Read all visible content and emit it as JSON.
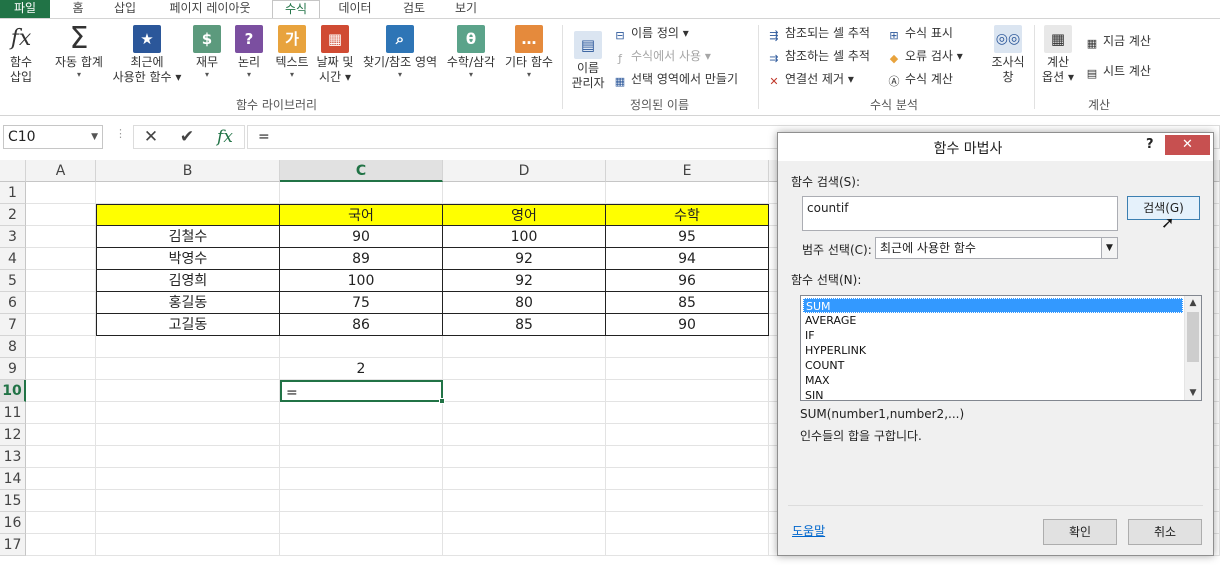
{
  "tabs": [
    "파일",
    "홈",
    "삽입",
    "페이지 레이아웃",
    "수식",
    "데이터",
    "검토",
    "보기"
  ],
  "ribbon": {
    "insert_function": {
      "line1": "함수",
      "line2": "삽입",
      "icon": "fx-icon"
    },
    "autosum": {
      "label": "자동 합계",
      "icon": "sigma-icon"
    },
    "recent": {
      "line1": "최근에",
      "line2": "사용한 함수",
      "icon": "star-icon"
    },
    "finance": {
      "label": "재무",
      "icon": "finance-icon"
    },
    "logical": {
      "label": "논리",
      "icon": "question-icon"
    },
    "text": {
      "label": "텍스트",
      "icon": "text-icon"
    },
    "datetime": {
      "line1": "날짜 및",
      "line2": "시간",
      "icon": "calendar-icon"
    },
    "lookup": {
      "label": "찾기/참조 영역",
      "icon": "lookup-icon"
    },
    "math": {
      "label": "수학/삼각",
      "icon": "theta-icon"
    },
    "more": {
      "label": "기타 함수",
      "icon": "more-icon"
    },
    "library_group": "함수 라이브러리",
    "name_manager": {
      "line1": "이름",
      "line2": "관리자",
      "icon": "name-manager-icon"
    },
    "define_name": "이름 정의",
    "use_in_formula": "수식에서 사용",
    "create_from_selection": "선택 영역에서 만들기",
    "names_group": "정의된 이름",
    "trace_precedents": "참조되는 셀 추적",
    "trace_dependents": "참조하는 셀 추적",
    "remove_arrows": "연결선 제거",
    "show_formulas": "수식 표시",
    "error_checking": "오류 검사",
    "evaluate_formula": "수식 계산",
    "watch_window": {
      "line1": "조사식",
      "line2": "창",
      "icon": "glasses-icon"
    },
    "audit_group": "수식 분석",
    "calc_options": {
      "line1": "계산",
      "line2": "옵션",
      "icon": "calculator-icon"
    },
    "calc_now": "지금 계산",
    "calc_sheet": "시트 계산",
    "calc_group": "계산"
  },
  "formula_bar": {
    "name_box": "C10",
    "cancel": "✕",
    "enter": "✔",
    "fx": "fx",
    "formula": "="
  },
  "sheet": {
    "columns": [
      "A",
      "B",
      "C",
      "D",
      "E"
    ],
    "rows": [
      "1",
      "2",
      "3",
      "4",
      "5",
      "6",
      "7",
      "8",
      "9",
      "10",
      "11",
      "12",
      "13",
      "14",
      "15",
      "16",
      "17"
    ],
    "headers": [
      "국어",
      "영어",
      "수학"
    ],
    "students": [
      {
        "name": "김철수",
        "korean": "90",
        "english": "100",
        "math": "95"
      },
      {
        "name": "박영수",
        "korean": "89",
        "english": "92",
        "math": "94"
      },
      {
        "name": "김영희",
        "korean": "100",
        "english": "92",
        "math": "96"
      },
      {
        "name": "홍길동",
        "korean": "75",
        "english": "80",
        "math": "85"
      },
      {
        "name": "고길동",
        "korean": "86",
        "english": "85",
        "math": "90"
      }
    ],
    "c9": "2",
    "c10": "="
  },
  "dialog": {
    "title": "함수 마법사",
    "help": "?",
    "close": "✕",
    "search_label": "함수 검색(S):",
    "search_value": "countif",
    "search_button": "검색(G)",
    "category_label": "범주 선택(C):",
    "category_value": "최근에 사용한 함수",
    "function_label": "함수 선택(N):",
    "functions": [
      "SUM",
      "AVERAGE",
      "IF",
      "HYPERLINK",
      "COUNT",
      "MAX",
      "SIN"
    ],
    "syntax": "SUM(number1,number2,...)",
    "description": "인수들의 합을 구합니다.",
    "help_link": "도움말",
    "ok": "확인",
    "cancel": "취소"
  },
  "colors": {
    "excel_green": "#217346",
    "highlight_yellow": "#ffff00",
    "selection_blue": "#3399ff"
  }
}
